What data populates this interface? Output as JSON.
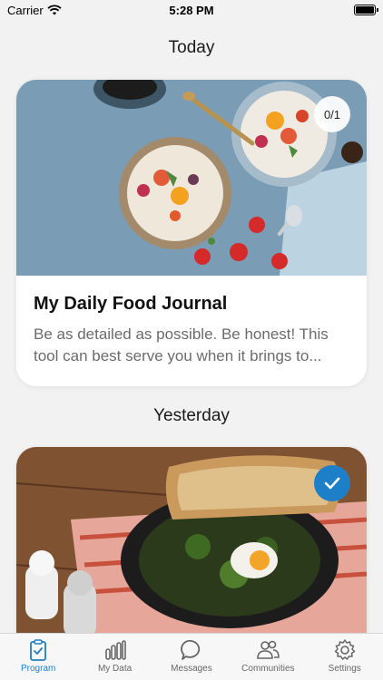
{
  "status_bar": {
    "carrier": "Carrier",
    "time": "5:28 PM"
  },
  "sections": {
    "today": "Today",
    "yesterday": "Yesterday"
  },
  "cards": [
    {
      "title": "My Daily Food Journal",
      "description": "Be as detailed as possible. Be honest! This tool can best serve you when it brings to...",
      "progress": "0/1"
    },
    {
      "completed": true
    }
  ],
  "tabs": [
    {
      "label": "Program",
      "icon": "clipboard-check-icon",
      "active": true
    },
    {
      "label": "My Data",
      "icon": "bar-chart-icon",
      "active": false
    },
    {
      "label": "Messages",
      "icon": "chat-bubble-icon",
      "active": false
    },
    {
      "label": "Communities",
      "icon": "people-icon",
      "active": false
    },
    {
      "label": "Settings",
      "icon": "gear-icon",
      "active": false
    }
  ],
  "colors": {
    "accent": "#1e7fc9",
    "background": "#f2f2f2"
  }
}
